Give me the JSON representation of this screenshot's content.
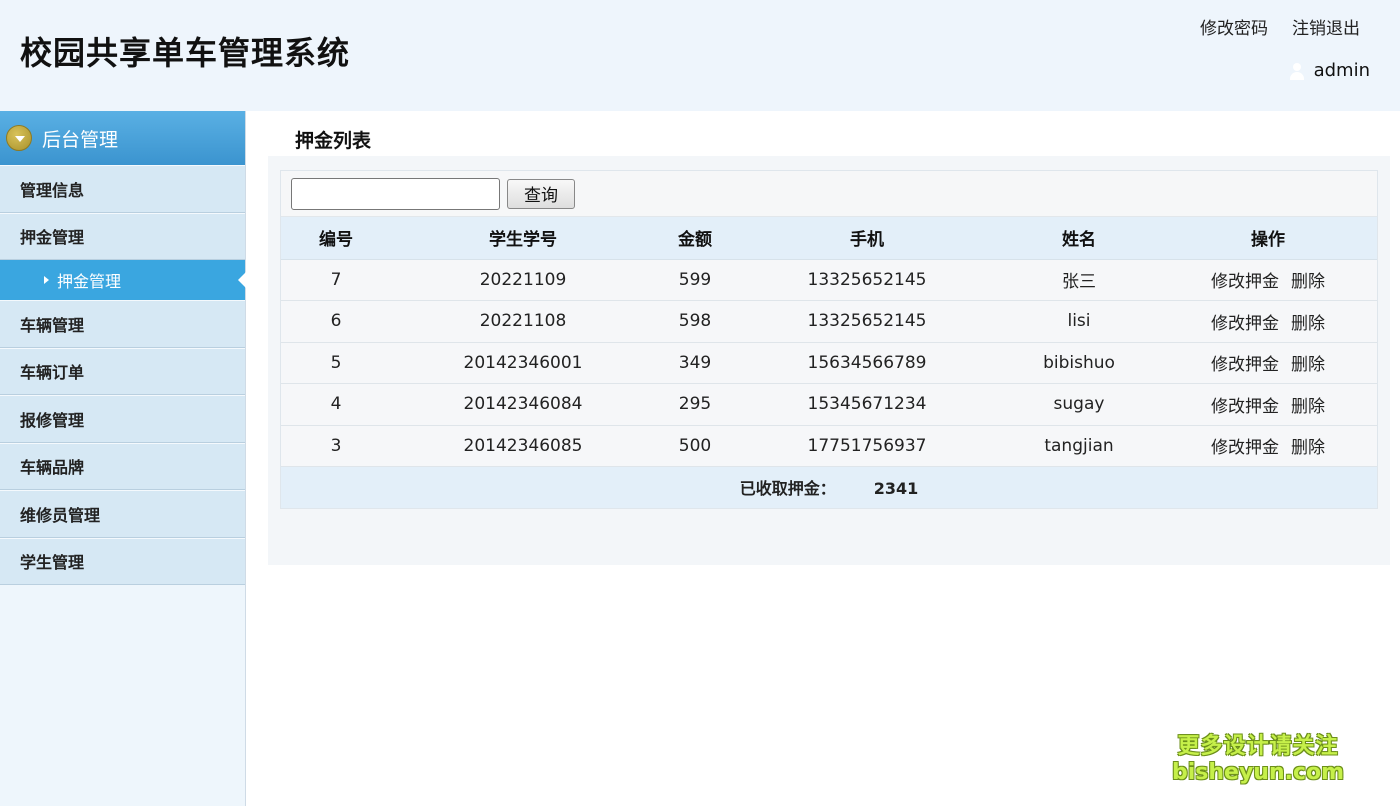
{
  "header": {
    "title": "校园共享单车管理系统",
    "change_password": "修改密码",
    "logout": "注销退出",
    "username": "admin"
  },
  "sidebar": {
    "title": "后台管理",
    "items": [
      {
        "label": "管理信息"
      },
      {
        "label": "押金管理"
      },
      {
        "label": "押金管理",
        "sub": true,
        "active": true
      },
      {
        "label": "车辆管理"
      },
      {
        "label": "车辆订单"
      },
      {
        "label": "报修管理"
      },
      {
        "label": "车辆品牌"
      },
      {
        "label": "维修员管理"
      },
      {
        "label": "学生管理"
      }
    ]
  },
  "main": {
    "section_title": "押金列表",
    "search": {
      "value": "",
      "placeholder": "",
      "button_label": "查询"
    },
    "columns": [
      "编号",
      "学生学号",
      "金额",
      "手机",
      "姓名",
      "操作"
    ],
    "rows": [
      {
        "id": "7",
        "student_no": "20221109",
        "amount": "599",
        "phone": "13325652145",
        "name": "张三",
        "edit": "修改押金",
        "delete": "删除"
      },
      {
        "id": "6",
        "student_no": "20221108",
        "amount": "598",
        "phone": "13325652145",
        "name": "lisi",
        "edit": "修改押金",
        "delete": "删除"
      },
      {
        "id": "5",
        "student_no": "20142346001",
        "amount": "349",
        "phone": "15634566789",
        "name": "bibishuo",
        "edit": "修改押金",
        "delete": "删除"
      },
      {
        "id": "4",
        "student_no": "20142346084",
        "amount": "295",
        "phone": "15345671234",
        "name": "sugay",
        "edit": "修改押金",
        "delete": "删除"
      },
      {
        "id": "3",
        "student_no": "20142346085",
        "amount": "500",
        "phone": "17751756937",
        "name": "tangjian",
        "edit": "修改押金",
        "delete": "删除"
      }
    ],
    "summary_label": "已收取押金：",
    "summary_value": "2341"
  },
  "watermark": {
    "line1": "更多设计请关注",
    "line2": "bisheyun.com"
  },
  "colors": {
    "sidebar_active": "#3aa6e0",
    "header_bg": "#eef5fc",
    "table_header": "#e3eff9"
  }
}
